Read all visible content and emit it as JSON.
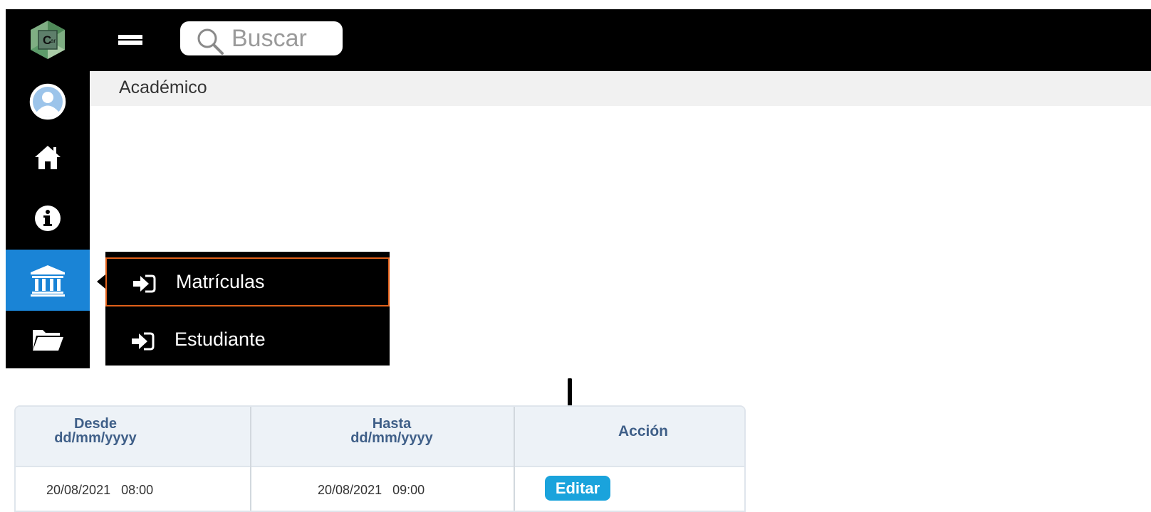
{
  "topbar": {
    "search": {
      "placeholder": "Buscar"
    }
  },
  "breadcrumb": {
    "label": "Académico"
  },
  "sidebar": {
    "items": [
      {
        "icon": "user-avatar-icon",
        "active": false
      },
      {
        "icon": "home-icon",
        "active": false
      },
      {
        "icon": "info-icon",
        "active": false
      },
      {
        "icon": "institution-icon",
        "active": true
      },
      {
        "icon": "folder-open-icon",
        "active": false
      }
    ]
  },
  "menu": {
    "items": [
      {
        "label": "Matrículas",
        "icon": "sign-in-arrow-icon",
        "highlighted": true
      },
      {
        "label": "Estudiante",
        "icon": "sign-in-arrow-icon",
        "highlighted": false
      }
    ]
  },
  "table": {
    "headers": {
      "desde": {
        "line1": "Desde",
        "line2": "dd/mm/yyyy"
      },
      "hasta": {
        "line1": "Hasta",
        "line2": "dd/mm/yyyy"
      },
      "accion": "Acción"
    },
    "rows": [
      {
        "desde": "20/08/2021   08:00",
        "hasta": "20/08/2021   09:00",
        "action_label": "Editar"
      }
    ]
  },
  "colors": {
    "topbar": "#000000",
    "active_sidebar": "#1a84d6",
    "highlight_border": "#e0601a",
    "header_text": "#3f5f88",
    "edit_button": "#1aa3dc"
  }
}
